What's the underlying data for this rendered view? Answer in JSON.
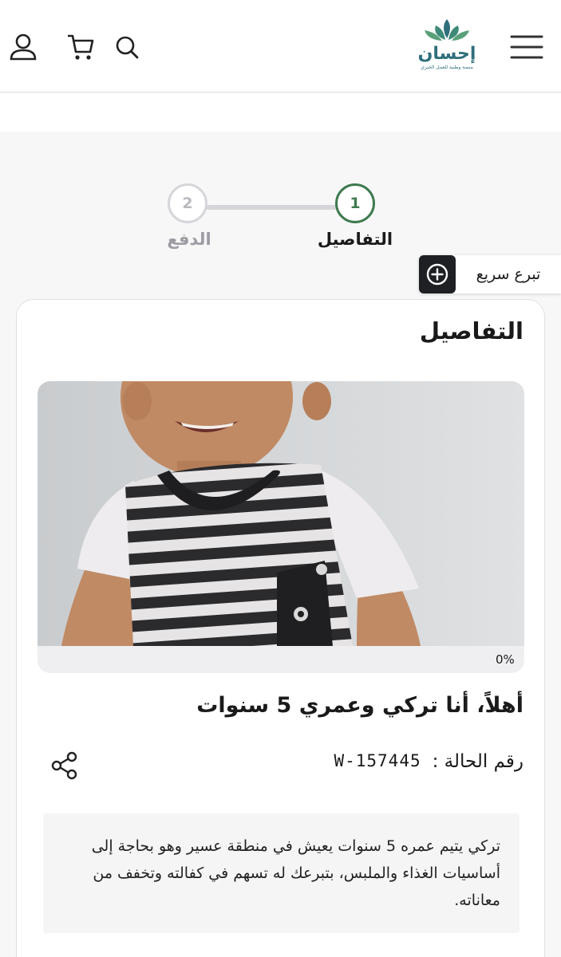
{
  "header": {
    "logo_word": "إحسان",
    "logo_tagline": "منصة وطنية للعمل الخيري",
    "icons": [
      "menu-icon",
      "search-icon",
      "cart-icon",
      "user-icon"
    ]
  },
  "stepper": {
    "steps": [
      {
        "number": "1",
        "label": "التفاصيل",
        "state": "active"
      },
      {
        "number": "2",
        "label": "الدفع",
        "state": "inactive"
      }
    ],
    "active_color": "#3f7a4f",
    "inactive_color": "#d6d6da"
  },
  "quick_donate": {
    "label": "تبرع سريع",
    "icon": "plus-circle-icon"
  },
  "details": {
    "section_title": "التفاصيل",
    "progress_percent_label": "0%",
    "progress_value": 0,
    "case_heading": "أهلاً، أنا تركي وعمري 5 سنوات",
    "case_number_label": "رقم الحالة :",
    "case_number_value": "W-157445",
    "description": "تركي يتيم عمره 5 سنوات يعيش في منطقة عسير وهو بحاجة إلى أساسيات الغذاء والملبس، بتبرعك له تسهم في كفالته وتخفف من معاناته."
  }
}
